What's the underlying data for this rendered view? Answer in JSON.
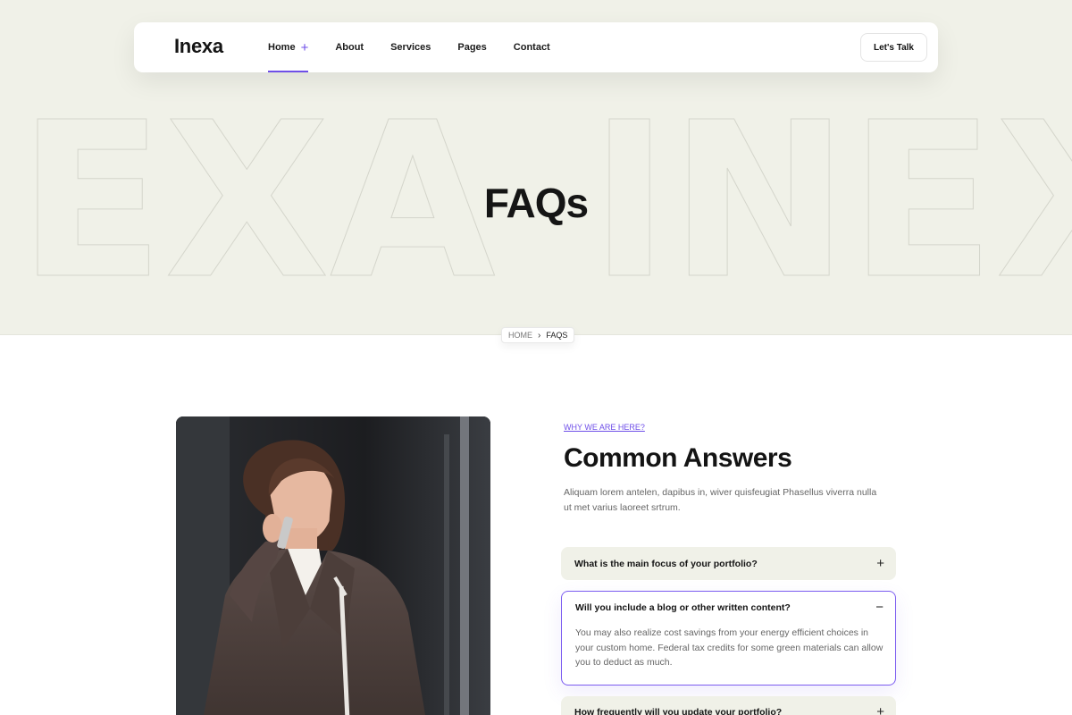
{
  "header": {
    "logo": "Inexa",
    "nav": [
      {
        "label": "Home",
        "plus": "+"
      },
      {
        "label": "About"
      },
      {
        "label": "Services"
      },
      {
        "label": "Pages"
      },
      {
        "label": "Contact"
      }
    ],
    "cta_label": "Let's Talk"
  },
  "hero": {
    "bg_word_left": "EXA",
    "bg_word_right": "INEX",
    "title": "FAQs"
  },
  "breadcrumb": {
    "home": "HOME",
    "separator": "›",
    "current": "FAQS"
  },
  "faq_section": {
    "eyebrow": "WHY WE ARE HERE?",
    "title": "Common Answers",
    "description": "Aliquam lorem antelen, dapibus in, wiver quisfeugiat Phasellus viverra nulla ut met varius laoreet srtrum.",
    "items": [
      {
        "question": "What is the main focus of your portfolio?",
        "toggle": "+"
      },
      {
        "question": "Will you include a blog or other written content?",
        "toggle": "−",
        "answer": "You may also realize cost savings from your energy efficient choices in your custom home. Federal tax credits for some green materials can allow you to deduct as much."
      },
      {
        "question": "How frequently will you update your portfolio?",
        "toggle": "+"
      }
    ]
  },
  "colors": {
    "accent": "#6e4ee8",
    "hero_bg": "#f0f1e8",
    "faq_closed_bg": "#f0f1e8",
    "text_dark": "#141414",
    "text_muted": "#666666"
  }
}
